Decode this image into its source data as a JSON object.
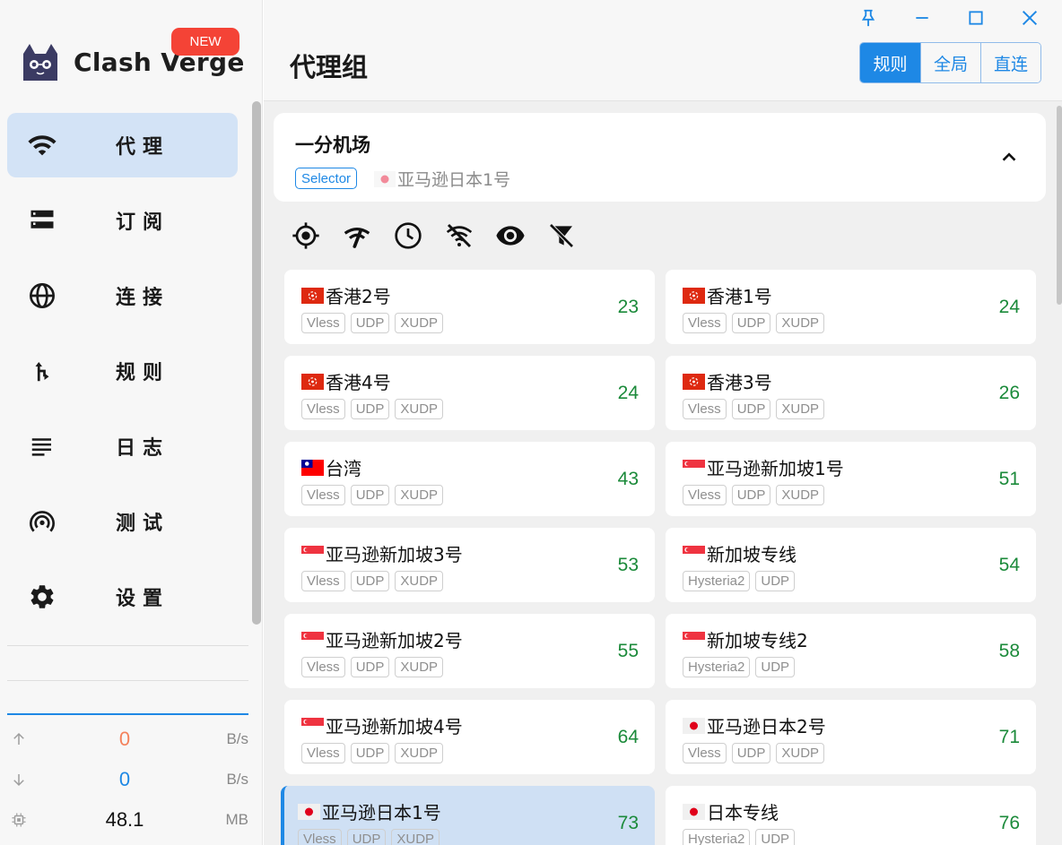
{
  "app": {
    "name": "Clash Verge",
    "badge": "NEW"
  },
  "sidebar": {
    "items": [
      {
        "label": "代理",
        "icon": "wifi-icon",
        "active": true
      },
      {
        "label": "订阅",
        "icon": "storage-icon",
        "active": false
      },
      {
        "label": "连接",
        "icon": "globe-icon",
        "active": false
      },
      {
        "label": "规则",
        "icon": "fork-arrow-icon",
        "active": false
      },
      {
        "label": "日志",
        "icon": "lines-icon",
        "active": false
      },
      {
        "label": "测试",
        "icon": "broadcast-icon",
        "active": false
      },
      {
        "label": "设置",
        "icon": "gear-icon",
        "active": false
      }
    ],
    "traffic": {
      "up": {
        "value": "0",
        "unit": "B/s",
        "color": "#f4825c"
      },
      "down": {
        "value": "0",
        "unit": "B/s",
        "color": "#1e88e5"
      },
      "memory": {
        "value": "48.1",
        "unit": "MB"
      }
    }
  },
  "header": {
    "title": "代理组",
    "modes": [
      {
        "label": "规则",
        "active": true
      },
      {
        "label": "全局",
        "active": false
      },
      {
        "label": "直连",
        "active": false
      }
    ]
  },
  "group": {
    "name": "一分机场",
    "type": "Selector",
    "current": "亚马逊日本1号"
  },
  "toolbar": [
    "locate-icon",
    "speed-test-icon",
    "clock-icon",
    "wifi-off-icon",
    "eye-icon",
    "filter-off-icon"
  ],
  "nodes": [
    {
      "name": "香港2号",
      "flag": "hk",
      "tags": [
        "Vless",
        "UDP",
        "XUDP"
      ],
      "delay": "23",
      "selected": false
    },
    {
      "name": "香港1号",
      "flag": "hk",
      "tags": [
        "Vless",
        "UDP",
        "XUDP"
      ],
      "delay": "24",
      "selected": false
    },
    {
      "name": "香港4号",
      "flag": "hk",
      "tags": [
        "Vless",
        "UDP",
        "XUDP"
      ],
      "delay": "24",
      "selected": false
    },
    {
      "name": "香港3号",
      "flag": "hk",
      "tags": [
        "Vless",
        "UDP",
        "XUDP"
      ],
      "delay": "26",
      "selected": false
    },
    {
      "name": "台湾",
      "flag": "tw",
      "tags": [
        "Vless",
        "UDP",
        "XUDP"
      ],
      "delay": "43",
      "selected": false
    },
    {
      "name": "亚马逊新加坡1号",
      "flag": "sg",
      "tags": [
        "Vless",
        "UDP",
        "XUDP"
      ],
      "delay": "51",
      "selected": false
    },
    {
      "name": "亚马逊新加坡3号",
      "flag": "sg",
      "tags": [
        "Vless",
        "UDP",
        "XUDP"
      ],
      "delay": "53",
      "selected": false
    },
    {
      "name": "新加坡专线",
      "flag": "sg",
      "tags": [
        "Hysteria2",
        "UDP"
      ],
      "delay": "54",
      "selected": false
    },
    {
      "name": "亚马逊新加坡2号",
      "flag": "sg",
      "tags": [
        "Vless",
        "UDP",
        "XUDP"
      ],
      "delay": "55",
      "selected": false
    },
    {
      "name": "新加坡专线2",
      "flag": "sg",
      "tags": [
        "Hysteria2",
        "UDP"
      ],
      "delay": "58",
      "selected": false
    },
    {
      "name": "亚马逊新加坡4号",
      "flag": "sg",
      "tags": [
        "Vless",
        "UDP",
        "XUDP"
      ],
      "delay": "64",
      "selected": false
    },
    {
      "name": "亚马逊日本2号",
      "flag": "jp",
      "tags": [
        "Vless",
        "UDP",
        "XUDP"
      ],
      "delay": "71",
      "selected": false
    },
    {
      "name": "亚马逊日本1号",
      "flag": "jp",
      "tags": [
        "Vless",
        "UDP",
        "XUDP"
      ],
      "delay": "73",
      "selected": true
    },
    {
      "name": "日本专线",
      "flag": "jp",
      "tags": [
        "Hysteria2",
        "UDP"
      ],
      "delay": "76",
      "selected": false
    }
  ],
  "colors": {
    "accent": "#1e88e5",
    "delay_good": "#1b8a3a",
    "badge": "#f44336"
  }
}
